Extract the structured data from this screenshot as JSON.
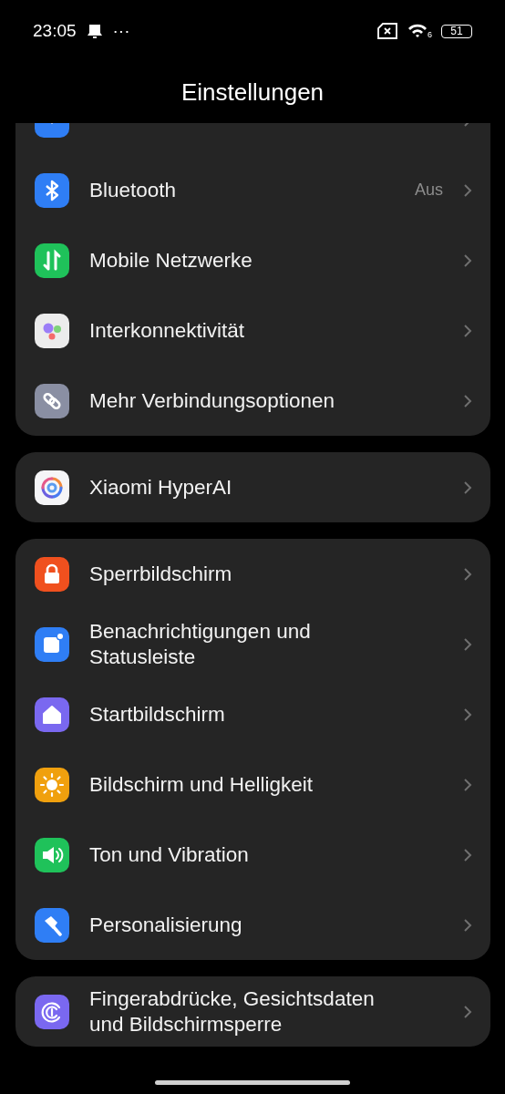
{
  "status_bar": {
    "time": "23:05",
    "more": "···",
    "wifi_badge": "6",
    "battery": "51"
  },
  "header": {
    "title": "Einstellungen"
  },
  "groups": [
    {
      "items": [
        {
          "kind": "cut_off"
        },
        {
          "kind": "setting",
          "label": "Bluetooth",
          "value": "Aus"
        },
        {
          "kind": "setting",
          "label": "Mobile Netzwerke"
        },
        {
          "kind": "setting",
          "label": "Interkonnektivität"
        },
        {
          "kind": "setting",
          "label": "Mehr Verbindungsoptionen"
        }
      ]
    },
    {
      "items": [
        {
          "kind": "setting",
          "label": "Xiaomi HyperAI"
        }
      ]
    },
    {
      "items": [
        {
          "kind": "setting",
          "label": "Sperrbildschirm"
        },
        {
          "kind": "setting",
          "label": "Benachrichtigungen und Statusleiste"
        },
        {
          "kind": "setting",
          "label": "Startbildschirm"
        },
        {
          "kind": "setting",
          "label": "Bildschirm und Helligkeit"
        },
        {
          "kind": "setting",
          "label": "Ton und Vibration"
        },
        {
          "kind": "setting",
          "label": "Personalisierung"
        }
      ]
    },
    {
      "items": [
        {
          "kind": "setting",
          "label": "Fingerabdrücke, Gesichtsdaten und Bildschirmsperre"
        }
      ]
    }
  ]
}
